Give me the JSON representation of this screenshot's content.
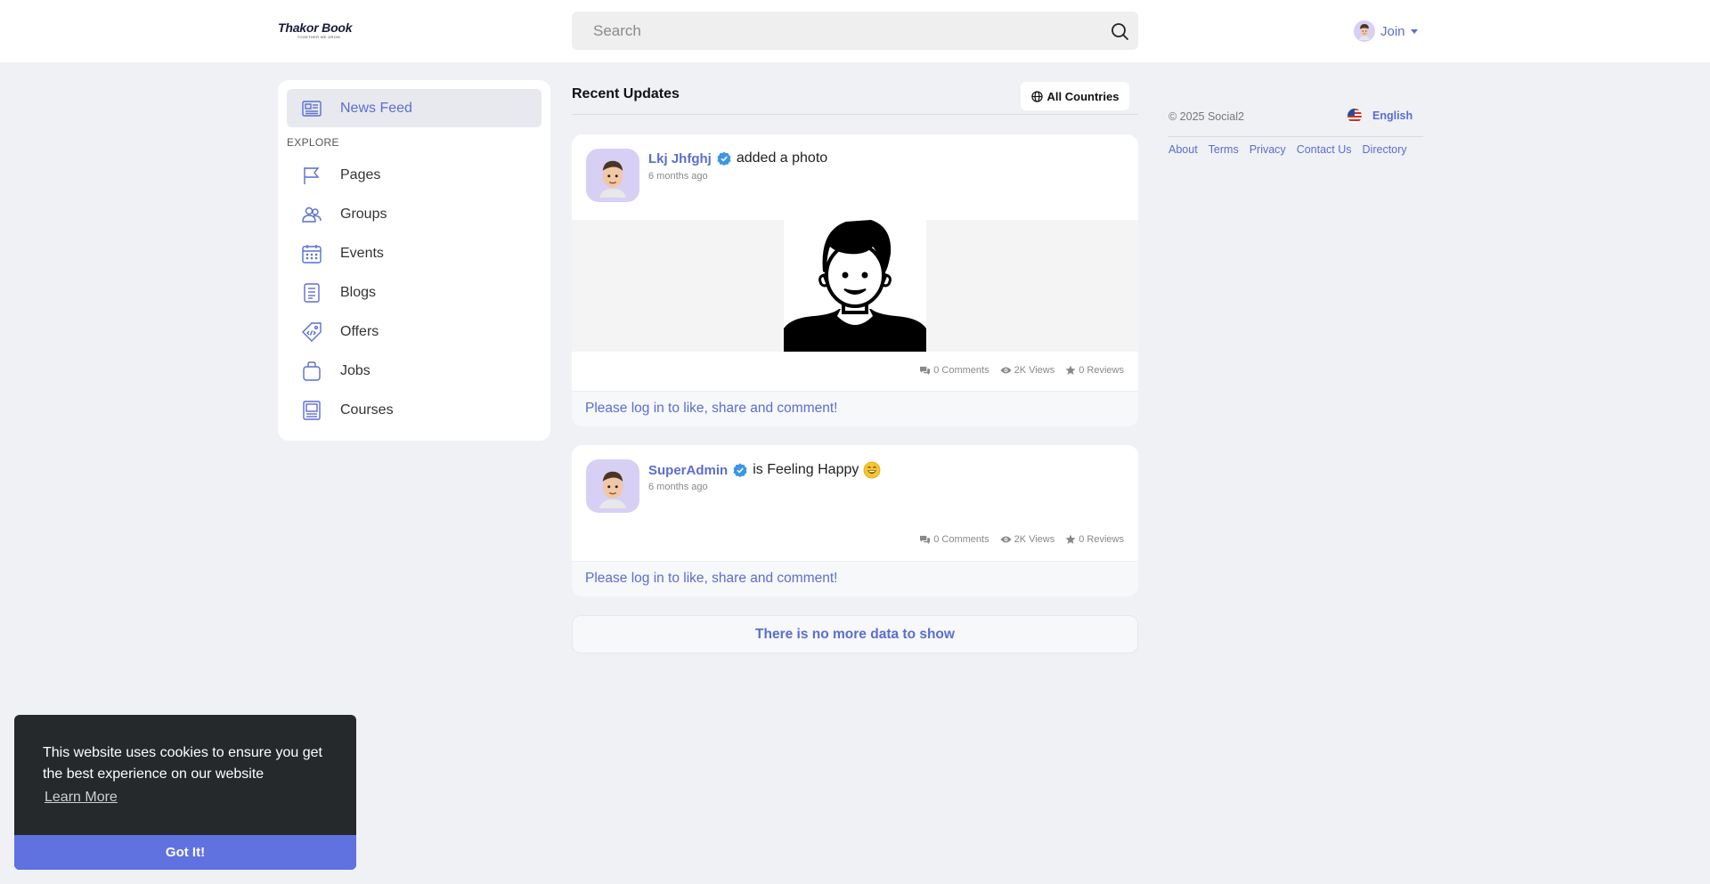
{
  "header": {
    "logo_text": "Thakor Book",
    "logo_tagline": "TOGETHER WE GROW",
    "search_placeholder": "Search",
    "join_label": "Join"
  },
  "sidebar": {
    "active_item": {
      "label": "News Feed",
      "icon": "newspaper-icon"
    },
    "explore_label": "EXPLORE",
    "items": [
      {
        "label": "Pages",
        "icon": "flag-icon"
      },
      {
        "label": "Groups",
        "icon": "users-icon"
      },
      {
        "label": "Events",
        "icon": "calendar-icon"
      },
      {
        "label": "Blogs",
        "icon": "document-icon"
      },
      {
        "label": "Offers",
        "icon": "tag-icon"
      },
      {
        "label": "Jobs",
        "icon": "briefcase-icon"
      },
      {
        "label": "Courses",
        "icon": "book-icon"
      }
    ]
  },
  "feed": {
    "title": "Recent Updates",
    "countries_label": "All Countries",
    "posts": [
      {
        "author": "Lkj Jhfghj",
        "action": "added a photo",
        "time": "6 months ago",
        "comments": "0 Comments",
        "views": "2K Views",
        "reviews": "0 Reviews",
        "footer": "Please log in to like, share and comment!"
      },
      {
        "author": "SuperAdmin",
        "action": "is Feeling Happy",
        "time": "6 months ago",
        "comments": "0 Comments",
        "views": "2K Views",
        "reviews": "0 Reviews",
        "footer": "Please log in to like, share and comment!"
      }
    ],
    "end_message": "There is no more data to show"
  },
  "right": {
    "copyright": "© 2025 Social2",
    "language": "English",
    "links": [
      "About",
      "Terms",
      "Privacy",
      "Contact Us",
      "Directory"
    ]
  },
  "cookie": {
    "message": "This website uses cookies to ensure you get the best experience on our website",
    "learn_more": "Learn More",
    "accept": "Got It!"
  },
  "colors": {
    "accent": "#5b6dd1",
    "page_bg": "#f0f1f5",
    "cookie_bg": "#25292b",
    "cookie_button": "#6071e0",
    "avatar_bg": "#d8cff5"
  }
}
